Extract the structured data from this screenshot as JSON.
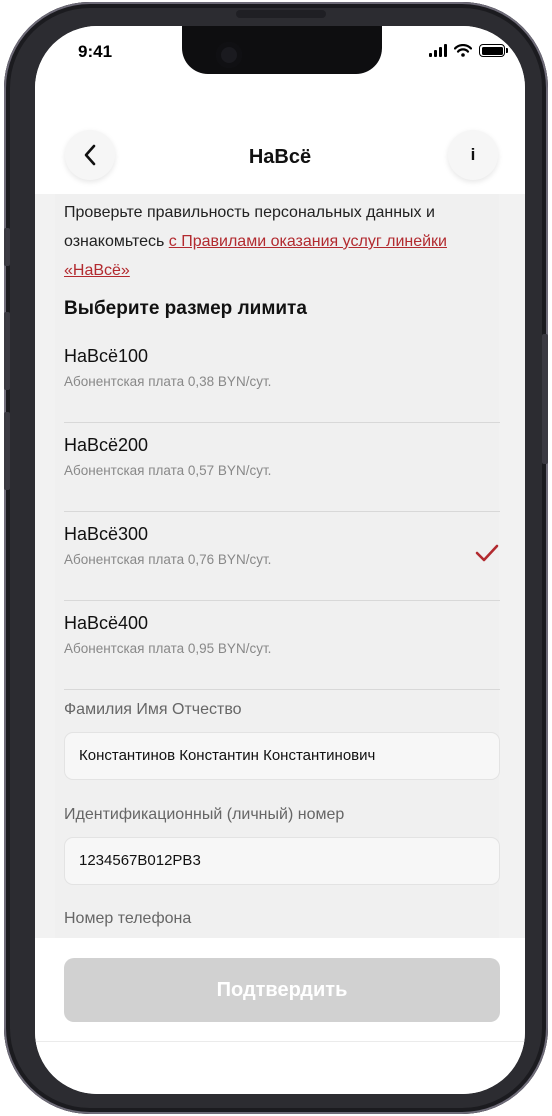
{
  "status": {
    "time": "9:41"
  },
  "nav": {
    "title": "НаВсё",
    "info_label": "i"
  },
  "intro": {
    "text": "Проверьте правильность персональных данных и ознакомьтесь ",
    "link": "с Правилами оказания услуг линейки «НаВсё»"
  },
  "limits": {
    "title": "Выберите размер лимита",
    "items": [
      {
        "name": "НаВсё100",
        "price": "Абонентская плата 0,38 BYN/сут.",
        "selected": false
      },
      {
        "name": "НаВсё200",
        "price": "Абонентская плата 0,57 BYN/сут.",
        "selected": false
      },
      {
        "name": "НаВсё300",
        "price": "Абонентская плата 0,76 BYN/сут.",
        "selected": true
      },
      {
        "name": "НаВсё400",
        "price": "Абонентская плата 0,95 BYN/сут.",
        "selected": false
      }
    ]
  },
  "form": {
    "fio_label": "Фамилия Имя Отчество",
    "fio_value": "Константинов Константин Константинович",
    "id_label": "Идентификационный (личный) номер",
    "id_value": "1234567B012PB3",
    "phone_label": "Номер телефона"
  },
  "confirm": {
    "label": "Подтвердить"
  },
  "colors": {
    "accent": "#b22a2f",
    "disabled_button": "#d1d1d1",
    "content_bg": "#f0f0f0"
  },
  "icons": {
    "back": "chevron-left-icon",
    "check": "checkmark-icon",
    "signal": "cellular-signal-icon",
    "wifi": "wifi-icon",
    "battery": "battery-icon"
  }
}
